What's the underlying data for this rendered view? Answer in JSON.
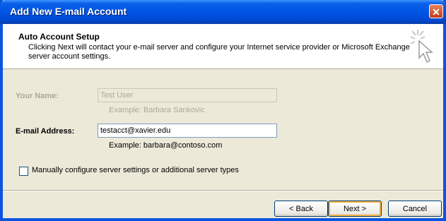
{
  "window": {
    "title": "Add New E-mail Account",
    "close_glyph": "✕"
  },
  "header": {
    "title": "Auto Account Setup",
    "description": "Clicking Next will contact your e-mail server and configure your Internet service provider or Microsoft Exchange server account settings."
  },
  "form": {
    "name_label": "Your Name:",
    "name_value": "Test User",
    "name_example": "Example: Barbara Sankovic",
    "email_label": "E-mail Address:",
    "email_value": "testacct@xavier.edu",
    "email_example": "Example: barbara@contoso.com",
    "manual_label": "Manually configure server settings or additional server types"
  },
  "buttons": {
    "back": "< Back",
    "next": "Next >",
    "cancel": "Cancel"
  }
}
